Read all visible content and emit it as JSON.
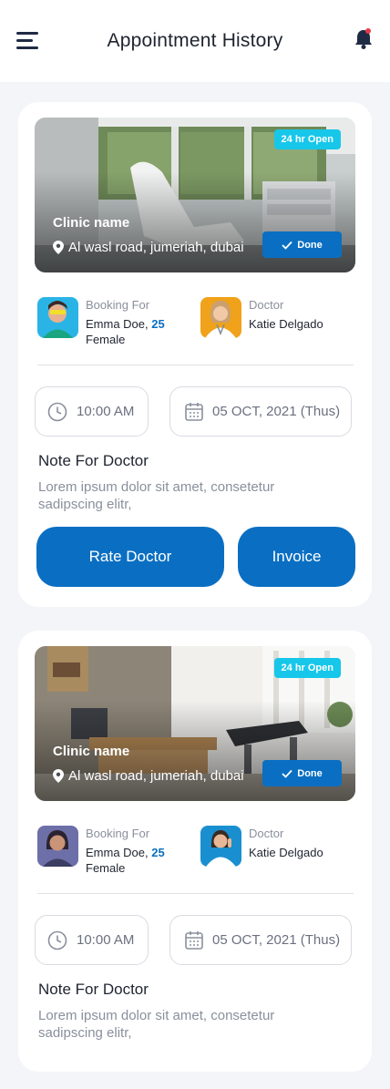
{
  "header": {
    "title": "Appointment History",
    "menu_icon": "hamburger-menu-icon",
    "notification_icon": "bell-icon",
    "notification_dot_color": "#e53946"
  },
  "colors": {
    "primary": "#0a6fc2",
    "badge": "#17c7ea",
    "muted": "#8a8f9c"
  },
  "appointments": [
    {
      "badge": "24 hr Open",
      "clinic_name": "Clinic name",
      "address": "Al wasl road, jumeriah, dubai",
      "status": "Done",
      "booking_for_label": "Booking For",
      "patient_name": "Emma Doe,",
      "patient_age": "25",
      "patient_gender": "Female",
      "doctor_label": "Doctor",
      "doctor_name": "Katie Delgado",
      "time": "10:00 AM",
      "date": "05 OCT, 2021 (Thus)",
      "note_title": "Note For Doctor",
      "note_text": "Lorem ipsum dolor sit amet, consetetur sadipscing elitr,",
      "rate_label": "Rate Doctor",
      "invoice_label": "Invoice"
    },
    {
      "badge": "24 hr Open",
      "clinic_name": "Clinic name",
      "address": "Al wasl road, jumeriah, dubai",
      "status": "Done",
      "booking_for_label": "Booking For",
      "patient_name": "Emma Doe,",
      "patient_age": "25",
      "patient_gender": "Female",
      "doctor_label": "Doctor",
      "doctor_name": "Katie Delgado",
      "time": "10:00 AM",
      "date": "05 OCT, 2021 (Thus)",
      "note_title": "Note For Doctor",
      "note_text": "Lorem ipsum dolor sit amet, consetetur sadipscing elitr,"
    }
  ]
}
